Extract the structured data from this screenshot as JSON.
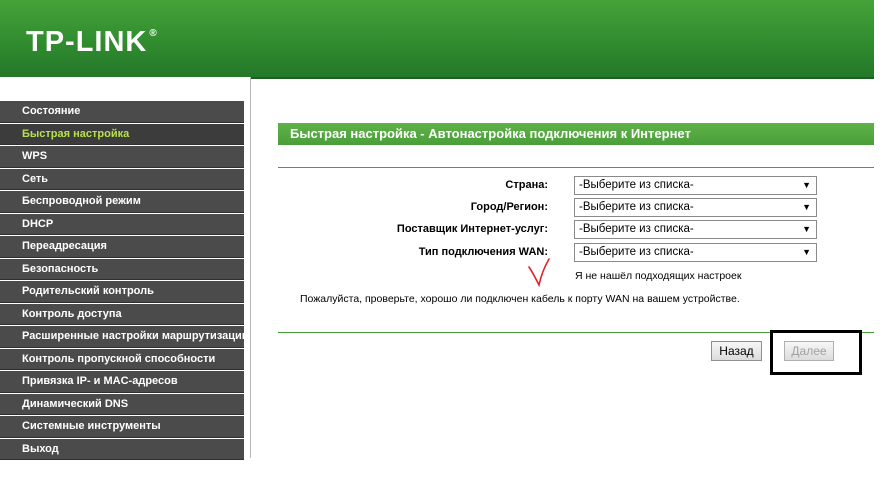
{
  "brand": {
    "logo_text": "TP-LINK",
    "trademark": "®"
  },
  "sidebar": {
    "items": [
      {
        "label": "Состояние",
        "active": false
      },
      {
        "label": "Быстрая настройка",
        "active": true
      },
      {
        "label": "WPS",
        "active": false
      },
      {
        "label": "Сеть",
        "active": false
      },
      {
        "label": "Беспроводной режим",
        "active": false
      },
      {
        "label": "DHCP",
        "active": false
      },
      {
        "label": "Переадресация",
        "active": false
      },
      {
        "label": "Безопасность",
        "active": false
      },
      {
        "label": "Родительский контроль",
        "active": false
      },
      {
        "label": "Контроль доступа",
        "active": false
      },
      {
        "label": "Расширенные настройки маршрутизации",
        "active": false
      },
      {
        "label": "Контроль пропускной способности",
        "active": false
      },
      {
        "label": "Привязка IP- и MAC-адресов",
        "active": false
      },
      {
        "label": "Динамический DNS",
        "active": false
      },
      {
        "label": "Системные инструменты",
        "active": false
      },
      {
        "label": "Выход",
        "active": false
      }
    ]
  },
  "main": {
    "title": "Быстрая настройка - Автонастройка подключения к Интернет",
    "fields": [
      {
        "label": "Страна:",
        "value": "-Выберите из списка-"
      },
      {
        "label": "Город/Регион:",
        "value": "-Выберите из списка-"
      },
      {
        "label": "Поставщик Интернет-услуг:",
        "value": "-Выберите из списка-"
      },
      {
        "label": "Тип подключения WAN:",
        "value": "-Выберите из списка-"
      }
    ],
    "checkbox_label": "Я не нашёл подходящих настроек",
    "checkbox_checked": false,
    "hint": "Пожалуйста, проверьте, хорошо ли подключен кабель к порту WAN на вашем устройстве.",
    "back_label": "Назад",
    "next_label": "Далее",
    "next_disabled": true
  },
  "colors": {
    "header": "#2f8a2d",
    "menu_bg": "#4b4b4b",
    "menu_active_text": "#b7e04f",
    "title_bar": "#5fb247"
  },
  "icons": {
    "dropdown": "chevron-down-icon",
    "annotation": "red-checkmark"
  }
}
